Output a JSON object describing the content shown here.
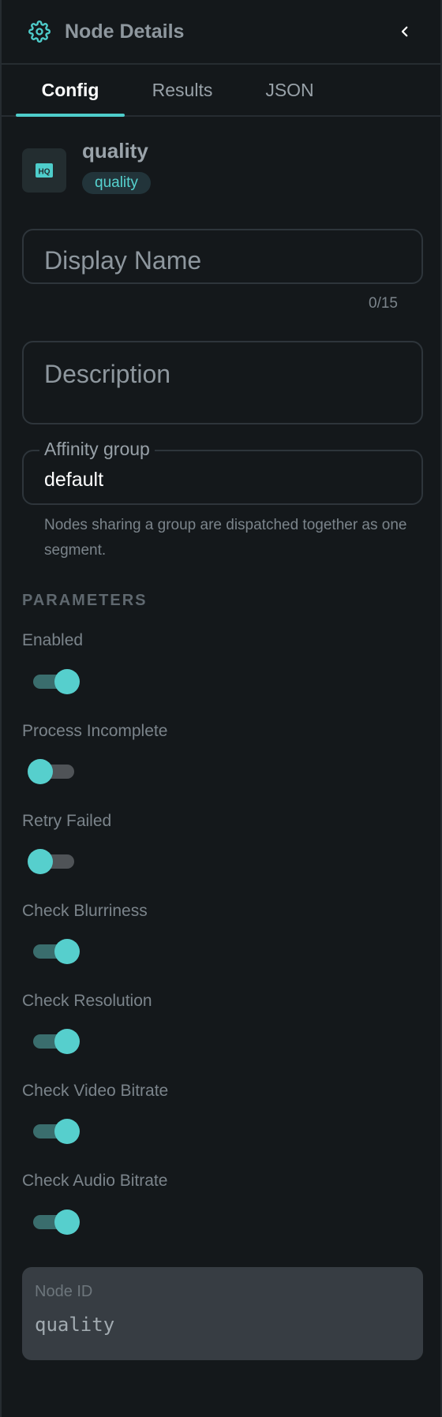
{
  "header": {
    "title": "Node Details",
    "icon": "gear-icon",
    "back_icon": "chevron-left-icon"
  },
  "tabs": [
    {
      "label": "Config",
      "active": true
    },
    {
      "label": "Results",
      "active": false
    },
    {
      "label": "JSON",
      "active": false
    }
  ],
  "node": {
    "name": "quality",
    "type": "quality",
    "icon_label": "HQ"
  },
  "fields": {
    "display_name": {
      "placeholder": "Display Name",
      "value": "",
      "counter": "0/15"
    },
    "description": {
      "placeholder": "Description",
      "value": ""
    },
    "affinity_group": {
      "label": "Affinity group",
      "value": "default",
      "helper": "Nodes sharing a group are dispatched together as one segment."
    }
  },
  "parameters": {
    "title": "PARAMETERS",
    "items": [
      {
        "label": "Enabled",
        "on": true
      },
      {
        "label": "Process Incomplete",
        "on": false
      },
      {
        "label": "Retry Failed",
        "on": false
      },
      {
        "label": "Check Blurriness",
        "on": true
      },
      {
        "label": "Check Resolution",
        "on": true
      },
      {
        "label": "Check Video Bitrate",
        "on": true
      },
      {
        "label": "Check Audio Bitrate",
        "on": true
      }
    ]
  },
  "node_id": {
    "label": "Node ID",
    "value": "quality"
  },
  "colors": {
    "accent": "#4ecdcb",
    "background": "#14181b",
    "toggle_track_on": "#3a6d6d",
    "toggle_track_off": "#4f5357"
  }
}
